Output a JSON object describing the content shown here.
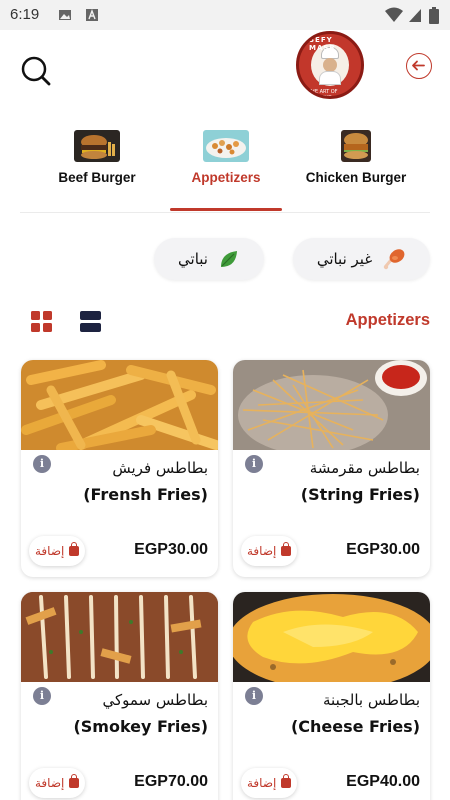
{
  "status_bar": {
    "time": "6:19"
  },
  "header": {
    "logo_text_top": "SEFY MASR",
    "logo_text_bottom": "THE ART OF COOKING"
  },
  "categories": [
    {
      "label": "Beef Burger",
      "active": false
    },
    {
      "label": "Appetizers",
      "active": true
    },
    {
      "label": "Chicken Burger",
      "active": false
    }
  ],
  "filters": {
    "non_vegetarian": "غير نباتي",
    "vegetarian": "نباتي"
  },
  "section": {
    "title": "Appetizers"
  },
  "products": [
    {
      "name_ar": "بطاطس مقرمشة",
      "name_en": "(String Fries)",
      "price": "EGP30.00",
      "add_label": "إضافة"
    },
    {
      "name_ar": "بطاطس فريش",
      "name_en": "(Frensh Fries)",
      "price": "EGP30.00",
      "add_label": "إضافة"
    },
    {
      "name_ar": "بطاطس بالجبنة",
      "name_en": "(Cheese Fries)",
      "price": "EGP40.00",
      "add_label": "إضافة"
    },
    {
      "name_ar": "بطاطس سموكي",
      "name_en": "(Smokey Fries)",
      "price": "EGP70.00",
      "add_label": "إضافة"
    }
  ],
  "colors": {
    "accent": "#c0392b",
    "chip_bg": "#f3f3f5",
    "dark": "#1d2340"
  },
  "icons": [
    "search-icon",
    "back-arrow-icon",
    "grid-view-icon",
    "list-view-icon",
    "info-icon",
    "bag-icon",
    "drumstick-icon",
    "leaf-icon"
  ]
}
